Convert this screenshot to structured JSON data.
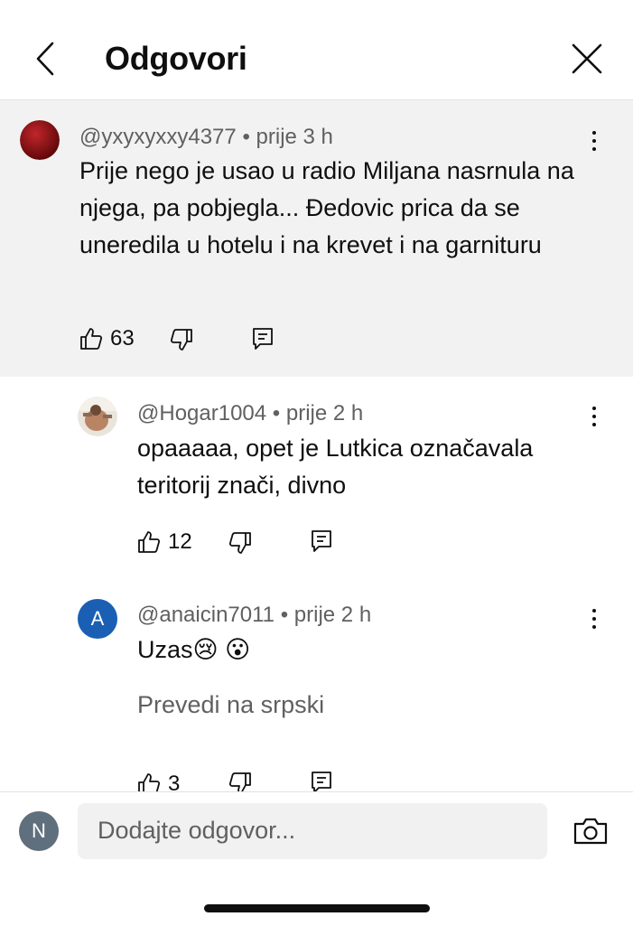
{
  "header": {
    "title": "Odgovori",
    "back_icon": "chevron-left-icon",
    "close_icon": "close-icon"
  },
  "comments": [
    {
      "author": "@yxyxyxxy4377",
      "time": "prije 3 h",
      "text": "Prije nego je usao u radio Miljana nasrnula na njega, pa pobjegla... Đedovic prica da se uneredila u hotelu i na krevet i na garnituru",
      "likes": "63",
      "avatar_color": "#8b0f12"
    },
    {
      "author": "@Hogar1004",
      "time": "prije 2 h",
      "text": "opaaaaa, opet je Lutkica označavala teritorij znači, divno",
      "likes": "12",
      "avatar_color": "#c9a98a"
    },
    {
      "author": "@anaicin7011",
      "time": "prije 2 h",
      "text": "Uzas😢 😮",
      "translate": "Prevedi na srpski",
      "likes": "3",
      "avatar_letter": "A",
      "avatar_color": "#1a5fb4"
    }
  ],
  "separator": "•",
  "composer": {
    "avatar_letter": "N",
    "placeholder": "Dodajte odgovor...",
    "camera_icon": "camera-icon"
  },
  "colors": {
    "parent_bg": "#f2f2f2",
    "meta": "#606060"
  }
}
